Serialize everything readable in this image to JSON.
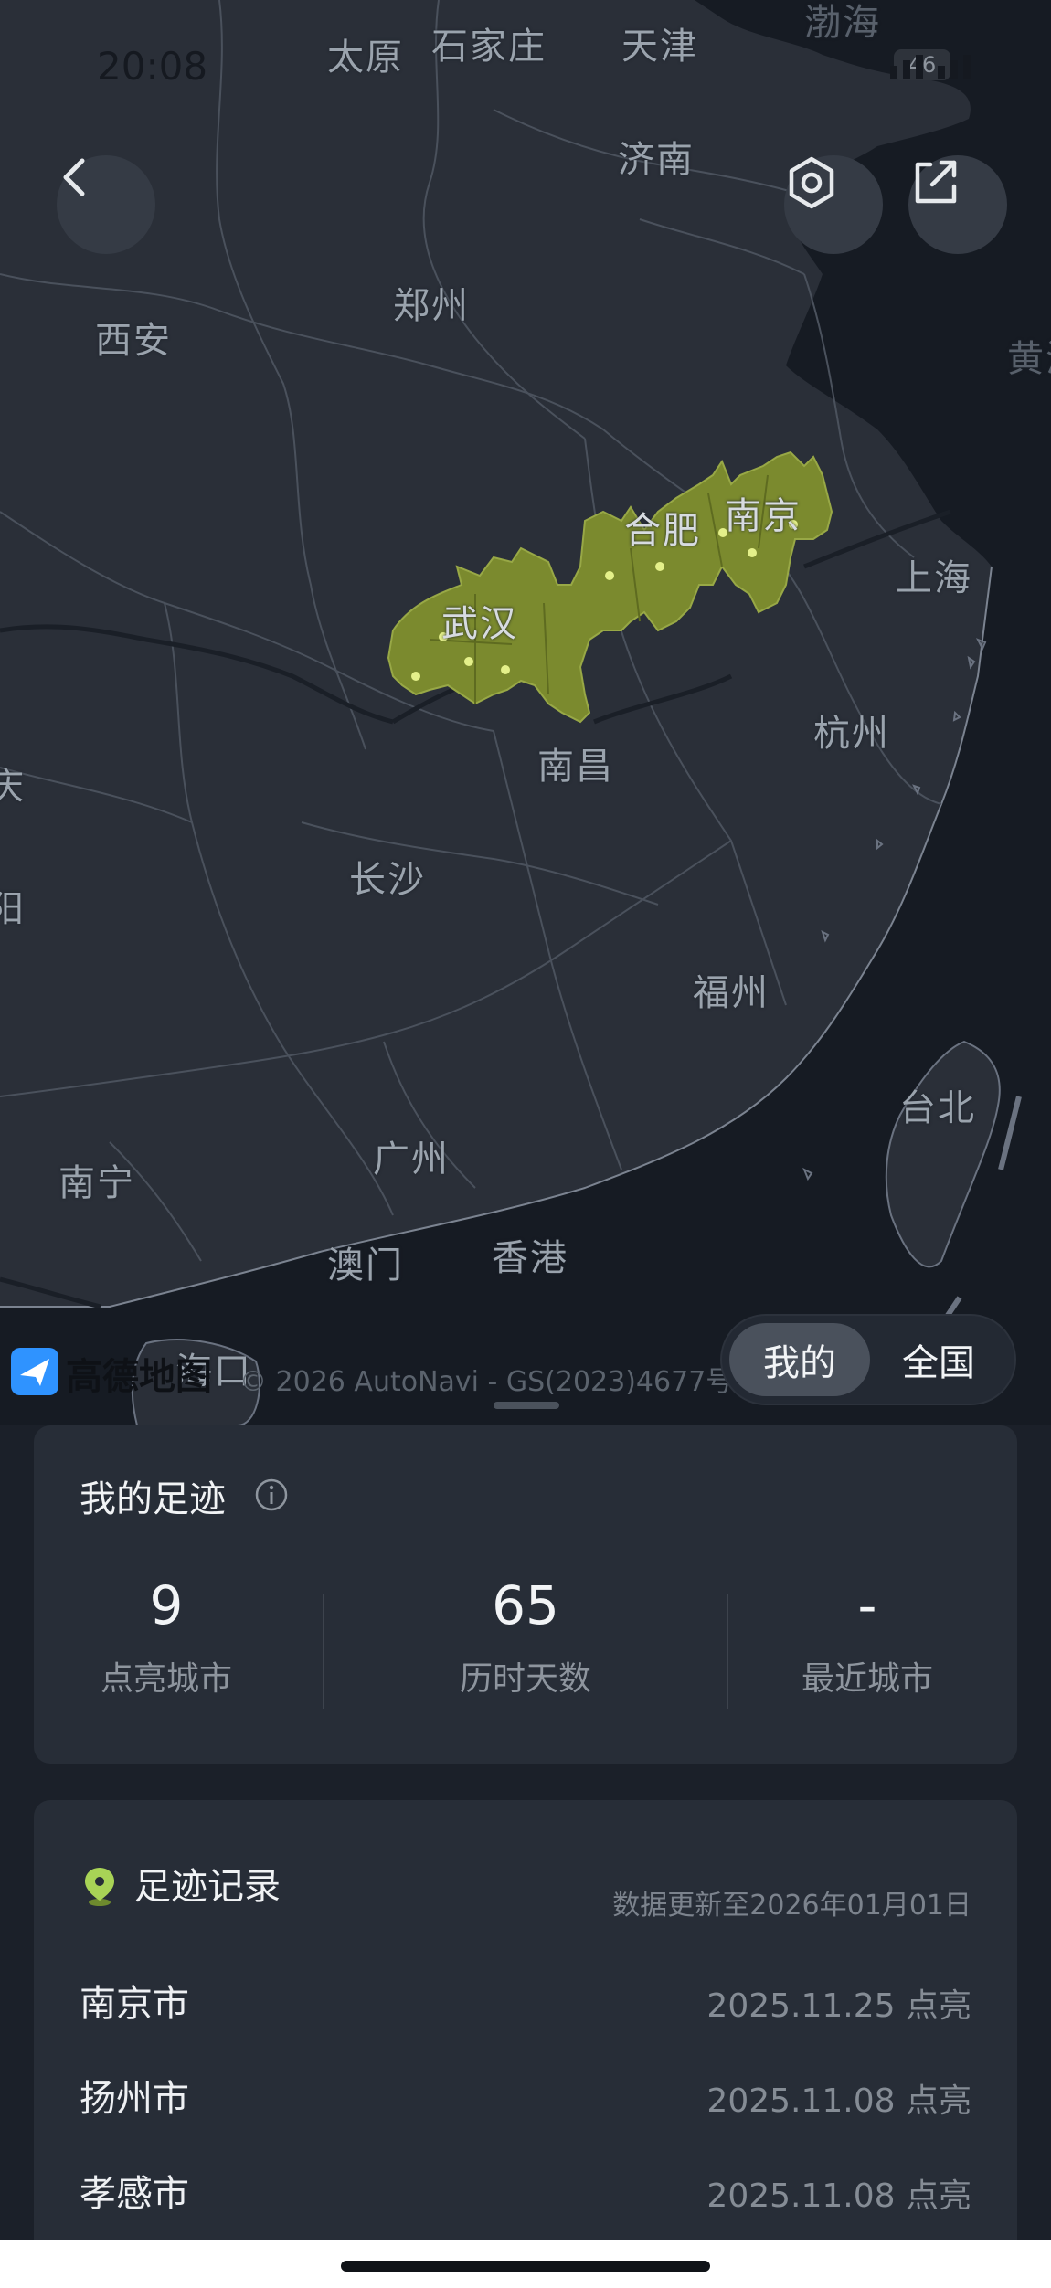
{
  "status_bar": {
    "time": "20:08",
    "battery": "46"
  },
  "map": {
    "attribution": {
      "brand": "高德地图",
      "copyright": "© 2026 AutoNavi - GS(2023)4677号"
    },
    "labels": {
      "bohai": "渤海",
      "taiyuan": "太原",
      "shijiazhuang": "石家庄",
      "tianjin": "天津",
      "jinan": "济南",
      "huanghai": "黄海",
      "xian": "西安",
      "zhengzhou": "郑州",
      "hefei": "合肥",
      "nanjing": "南京",
      "shanghai": "上海",
      "wuhan": "武汉",
      "hangzhou": "杭州",
      "nanchang": "南昌",
      "changsha": "长沙",
      "fuzhou": "福州",
      "taibei": "台北",
      "guangzhou": "广州",
      "nanning": "南宁",
      "aomen": "澳门",
      "xianggang": "香港",
      "haikou": "海口",
      "edge_left_1": "庆",
      "edge_left_2": "阳"
    },
    "icons": {
      "back": "chevron-left-icon",
      "settings": "hexagon-settings-icon",
      "share": "share-icon"
    },
    "highlight_color": "#7b8a2e",
    "dot_color": "#e4f08a"
  },
  "toggle": {
    "mine": "我的",
    "national": "全国"
  },
  "footprint": {
    "title": "我的足迹",
    "stats": [
      {
        "value": "9",
        "label": "点亮城市"
      },
      {
        "value": "65",
        "label": "历时天数"
      },
      {
        "value": "-",
        "label": "最近城市"
      }
    ]
  },
  "records": {
    "title": "足迹记录",
    "update_note": "数据更新至2026年01月01日",
    "items": [
      {
        "city": "南京市",
        "date": "2025.11.25 点亮"
      },
      {
        "city": "扬州市",
        "date": "2025.11.08 点亮"
      },
      {
        "city": "孝感市",
        "date": "2025.11.08 点亮"
      }
    ]
  }
}
